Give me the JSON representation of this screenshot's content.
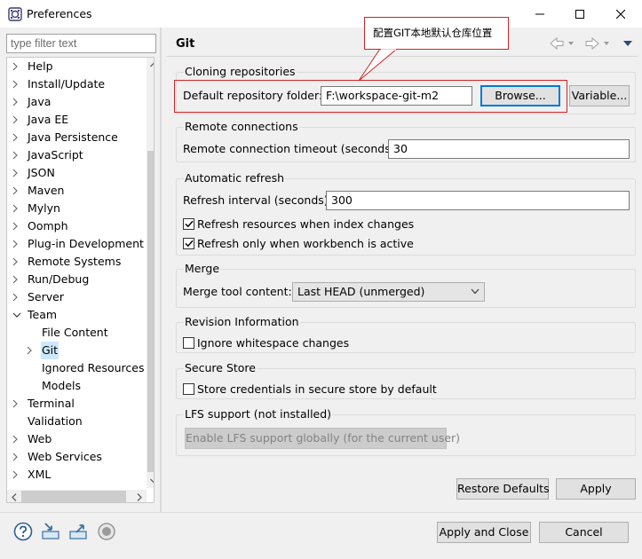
{
  "window": {
    "title": "Preferences"
  },
  "filter": {
    "placeholder": "type filter text"
  },
  "tree": [
    {
      "label": "Help",
      "level": 0,
      "expand": "collapsed"
    },
    {
      "label": "Install/Update",
      "level": 0,
      "expand": "collapsed"
    },
    {
      "label": "Java",
      "level": 0,
      "expand": "collapsed"
    },
    {
      "label": "Java EE",
      "level": 0,
      "expand": "collapsed"
    },
    {
      "label": "Java Persistence",
      "level": 0,
      "expand": "collapsed"
    },
    {
      "label": "JavaScript",
      "level": 0,
      "expand": "collapsed"
    },
    {
      "label": "JSON",
      "level": 0,
      "expand": "collapsed"
    },
    {
      "label": "Maven",
      "level": 0,
      "expand": "collapsed"
    },
    {
      "label": "Mylyn",
      "level": 0,
      "expand": "collapsed"
    },
    {
      "label": "Oomph",
      "level": 0,
      "expand": "collapsed"
    },
    {
      "label": "Plug-in Development",
      "level": 0,
      "expand": "collapsed"
    },
    {
      "label": "Remote Systems",
      "level": 0,
      "expand": "collapsed"
    },
    {
      "label": "Run/Debug",
      "level": 0,
      "expand": "collapsed"
    },
    {
      "label": "Server",
      "level": 0,
      "expand": "collapsed"
    },
    {
      "label": "Team",
      "level": 0,
      "expand": "expanded"
    },
    {
      "label": "File Content",
      "level": 1,
      "expand": "none"
    },
    {
      "label": "Git",
      "level": 1,
      "expand": "collapsed",
      "selected": true
    },
    {
      "label": "Ignored Resources",
      "level": 1,
      "expand": "none"
    },
    {
      "label": "Models",
      "level": 1,
      "expand": "none"
    },
    {
      "label": "Terminal",
      "level": 0,
      "expand": "collapsed"
    },
    {
      "label": "Validation",
      "level": 0,
      "expand": "none"
    },
    {
      "label": "Web",
      "level": 0,
      "expand": "collapsed"
    },
    {
      "label": "Web Services",
      "level": 0,
      "expand": "collapsed"
    },
    {
      "label": "XML",
      "level": 0,
      "expand": "collapsed"
    }
  ],
  "page": {
    "title": "Git",
    "callout": "配置GIT本地默认仓库位置",
    "cloning": {
      "group": "Cloning repositories",
      "folder_label": "Default repository folder:",
      "folder_value": "F:\\workspace-git-m2",
      "browse": "Browse...",
      "variable": "Variable..."
    },
    "remote": {
      "group": "Remote connections",
      "timeout_label": "Remote connection timeout (seconds):",
      "timeout_value": "30"
    },
    "refresh": {
      "group": "Automatic refresh",
      "interval_label": "Refresh interval (seconds):",
      "interval_value": "300",
      "on_index_change": "Refresh resources when index changes",
      "on_index_change_checked": true,
      "only_active": "Refresh only when workbench is active",
      "only_active_checked": true
    },
    "merge": {
      "group": "Merge",
      "tool_label": "Merge tool content:",
      "tool_value": "Last HEAD (unmerged)"
    },
    "revision": {
      "group": "Revision Information",
      "ignore_ws": "Ignore whitespace changes",
      "ignore_ws_checked": false
    },
    "secure": {
      "group": "Secure Store",
      "store_creds": "Store credentials in secure store by default",
      "store_creds_checked": false
    },
    "lfs": {
      "group": "LFS support (not installed)",
      "enable": "Enable LFS support globally (for the current user)"
    },
    "restore_defaults": "Restore Defaults",
    "apply": "Apply"
  },
  "footer": {
    "apply_close": "Apply and Close",
    "cancel": "Cancel"
  },
  "colors": {
    "accent": "#0078d7",
    "selection": "#cce8ff",
    "annotation": "#d32222"
  }
}
